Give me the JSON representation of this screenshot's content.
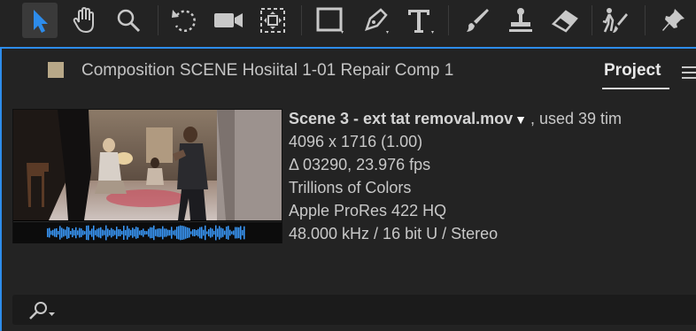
{
  "toolbar": {
    "tools": [
      {
        "icon": "selection-arrow-icon",
        "active": true
      },
      {
        "icon": "hand-icon",
        "active": false
      },
      {
        "icon": "zoom-magnifier-icon",
        "active": false
      },
      {
        "icon": "rotate-icon",
        "active": false
      },
      {
        "icon": "camera-icon",
        "active": false
      },
      {
        "icon": "pan-behind-icon",
        "active": false
      },
      {
        "icon": "rectangle-icon",
        "active": false
      },
      {
        "icon": "pen-icon",
        "active": false
      },
      {
        "icon": "type-icon",
        "active": false
      },
      {
        "icon": "brush-icon",
        "active": false
      },
      {
        "icon": "clone-stamp-icon",
        "active": false
      },
      {
        "icon": "eraser-icon",
        "active": false
      },
      {
        "icon": "roto-brush-icon",
        "active": false
      },
      {
        "icon": "puppet-pin-icon",
        "active": false
      }
    ]
  },
  "panel": {
    "composition_title": "Composition SCENE Hosiital 1-01 Repair Comp 1",
    "project_tab": "Project",
    "accent_color": "#2d8ceb",
    "swatch_color": "#b8a888"
  },
  "footage": {
    "name": "Scene 3 - ext tat removal.mov",
    "used": ", used 39 tim",
    "dimensions": "4096 x 1716 (1.00)",
    "duration": "Δ 03290, 23.976 fps",
    "colors": "Trillions of Colors",
    "codec": "Apple ProRes 422 HQ",
    "audio": "48.000 kHz / 16 bit U / Stereo"
  },
  "waveform_color": "#3a9bff",
  "search": {
    "placeholder": ""
  }
}
